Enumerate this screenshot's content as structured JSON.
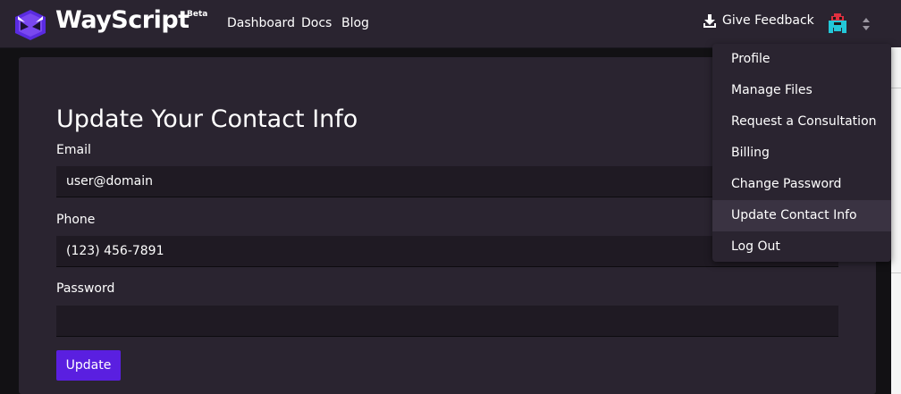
{
  "brand": {
    "name": "WayScript",
    "badge": "Beta"
  },
  "nav": {
    "links": [
      "Dashboard",
      "Docs",
      "Blog"
    ]
  },
  "header": {
    "feedback_label": "Give Feedback"
  },
  "form": {
    "title": "Update Your Contact Info",
    "email": {
      "label": "Email",
      "value": "user@domain"
    },
    "phone": {
      "label": "Phone",
      "value": "(123) 456-7891"
    },
    "password": {
      "label": "Password",
      "value": ""
    },
    "submit_label": "Update"
  },
  "dropdown": {
    "items": [
      "Profile",
      "Manage Files",
      "Request a Consultation",
      "Billing",
      "Change Password",
      "Update Contact Info",
      "Log Out"
    ],
    "active": "Update Contact Info"
  },
  "colors": {
    "background": "#121114",
    "surface": "#2a2430",
    "input": "#1f1a23",
    "accent": "#5a1fe0",
    "menu_highlight": "#3a3342"
  },
  "icons": [
    "wayscript-logo-icon",
    "download-icon",
    "user-avatar-icon",
    "sort-caret-icon"
  ]
}
